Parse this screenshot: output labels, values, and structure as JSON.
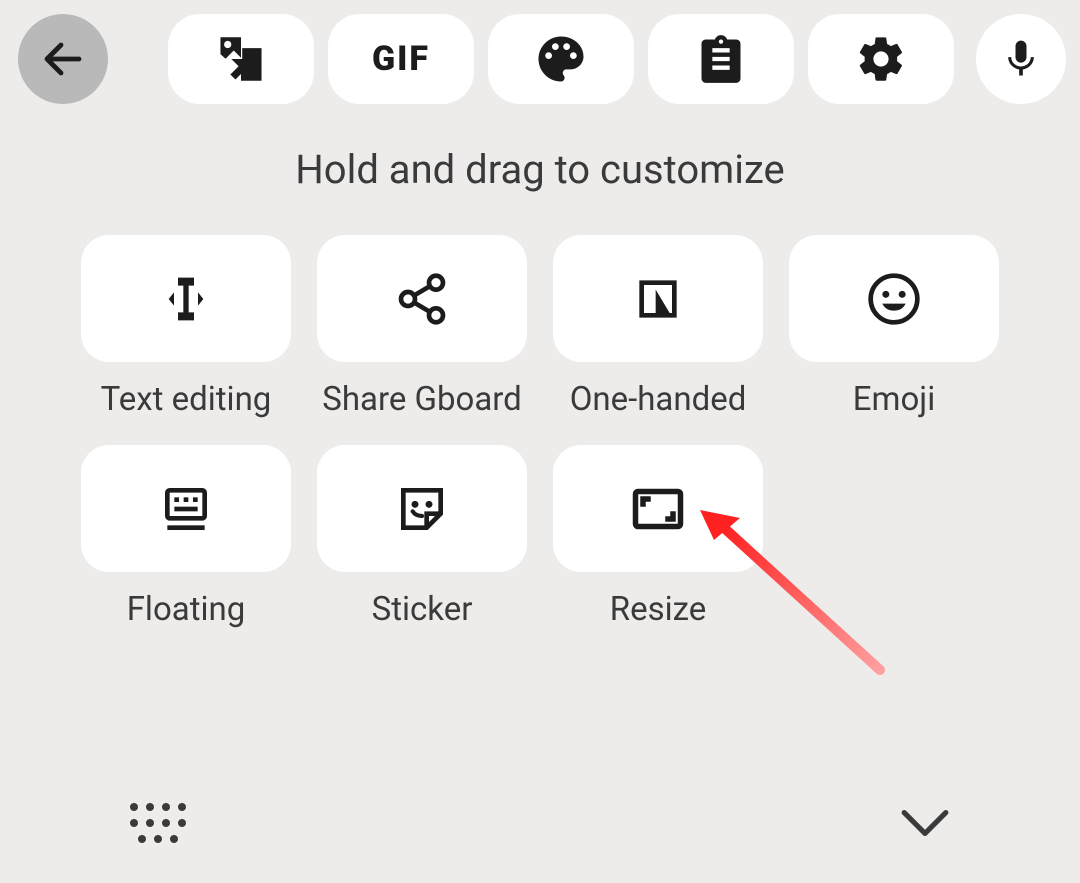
{
  "heading": "Hold and drag to customize",
  "tiles": {
    "text_editing": "Text editing",
    "share_gboard": "Share Gboard",
    "one_handed": "One-handed",
    "emoji": "Emoji",
    "floating": "Floating",
    "sticker": "Sticker",
    "resize": "Resize"
  },
  "toolbar": {
    "gif_label": "GIF"
  }
}
